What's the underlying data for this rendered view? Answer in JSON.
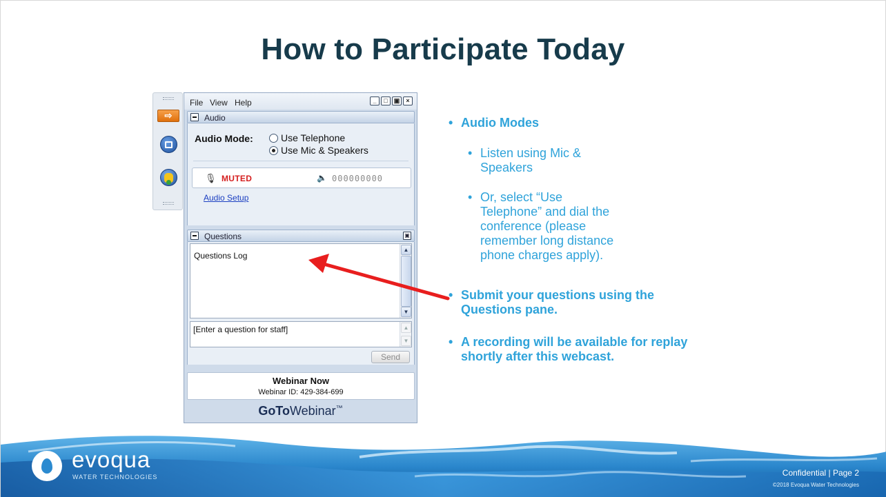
{
  "slide": {
    "title": "How to Participate Today"
  },
  "panel": {
    "menu": [
      "File",
      "View",
      "Help"
    ],
    "audio": {
      "section_label": "Audio",
      "mode_label": "Audio Mode:",
      "options": [
        "Use Telephone",
        "Use Mic & Speakers"
      ],
      "selected": "Use Mic & Speakers",
      "mute_status": "MUTED",
      "meter": "000000000",
      "setup_link": "Audio Setup"
    },
    "questions": {
      "section_label": "Questions",
      "log_title": "Questions Log",
      "input_placeholder": "[Enter a question for staff]",
      "send_label": "Send"
    },
    "webinar": {
      "name": "Webinar Now",
      "id_text": "Webinar ID: 429-384-699"
    },
    "brand": {
      "goto": "GoTo",
      "webinar": "Webinar",
      "tm": "™"
    }
  },
  "bullets": {
    "audio_modes": "Audio Modes",
    "sub1": "Listen using Mic & Speakers",
    "sub2": "Or, select “Use Telephone” and dial the conference (please remember long distance phone charges apply).",
    "submit": "Submit your questions using the Questions pane.",
    "recording": "A recording will be available for replay shortly after this webcast."
  },
  "footer": {
    "logo_word": "evoqua",
    "logo_sub": "WATER TECHNOLOGIES",
    "confidential": "Confidential | Page 2",
    "copyright": "©2018 Evoqua Water Technologies"
  },
  "colors": {
    "title": "#173b4b",
    "bullet": "#2fa3da",
    "arrow": "#e81e1e",
    "muted": "#d51f1f"
  }
}
